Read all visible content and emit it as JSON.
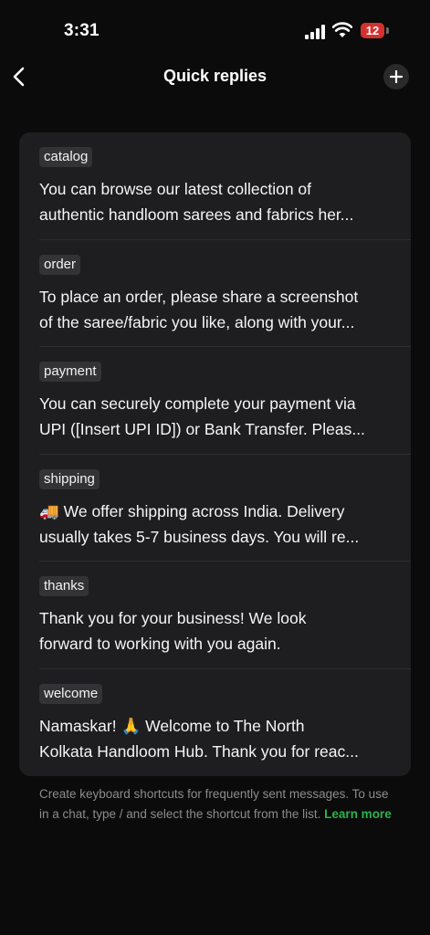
{
  "status": {
    "time": "3:31",
    "battery": "12",
    "battery_color": "#d3312e"
  },
  "nav": {
    "title": "Quick replies",
    "back_icon": "chevron-left-icon",
    "add_icon": "plus-icon"
  },
  "replies": [
    {
      "shortcut": "catalog",
      "line1": "You can browse our latest collection of",
      "line2": "authentic handloom sarees and fabrics her..."
    },
    {
      "shortcut": "order",
      "line1": "To place an order, please share a screenshot",
      "line2": "of the saree/fabric you like, along with your..."
    },
    {
      "shortcut": "payment",
      "line1": "You can securely complete your payment via",
      "line2": "UPI ([Insert UPI ID]) or Bank Transfer. Pleas..."
    },
    {
      "shortcut": "shipping",
      "line1": "🚚 We offer shipping across India. Delivery",
      "line2": "usually takes 5-7 business days. You will re..."
    },
    {
      "shortcut": "thanks",
      "line1": "Thank you for your business! We look",
      "line2": "forward to working with you again."
    },
    {
      "shortcut": "welcome",
      "line1": "Namaskar! 🙏 Welcome to The North",
      "line2": "Kolkata Handloom Hub. Thank you for reac..."
    }
  ],
  "footer": {
    "text": "Create keyboard shortcuts for frequently sent messages. To use in a chat, type / and select the shortcut from the list.",
    "link": "Learn more",
    "link_color": "#2ab24f"
  }
}
